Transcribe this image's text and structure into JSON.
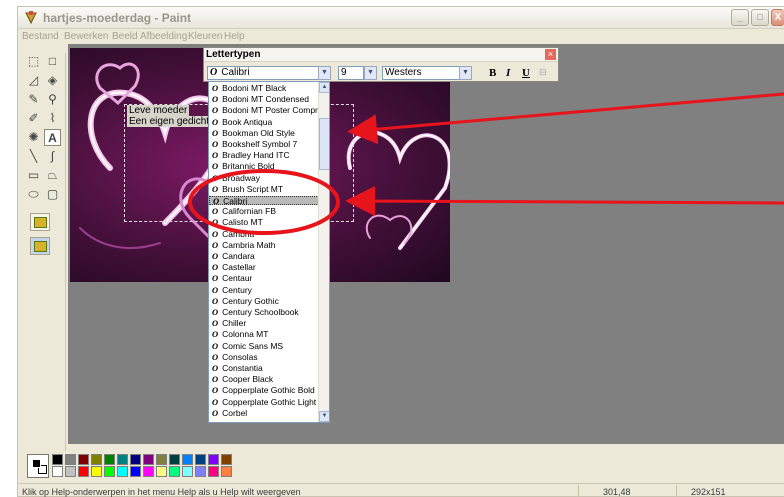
{
  "window": {
    "title": "hartjes-moederdag - Paint",
    "buttons": [
      "_",
      "□",
      "X"
    ]
  },
  "menu": [
    "Bestand",
    "Bewerken",
    "Beeld",
    "Afbeelding",
    "Kleuren",
    "Help"
  ],
  "toolbox": {
    "tools": [
      {
        "icon": "free-select-icon",
        "glyph": "⬚"
      },
      {
        "icon": "rect-select-icon",
        "glyph": "□"
      },
      {
        "icon": "eraser-icon",
        "glyph": "◿"
      },
      {
        "icon": "fill-icon",
        "glyph": "◈"
      },
      {
        "icon": "color-picker-icon",
        "glyph": "✎"
      },
      {
        "icon": "magnifier-icon",
        "glyph": "⚲"
      },
      {
        "icon": "pencil-icon",
        "glyph": "✐"
      },
      {
        "icon": "brush-icon",
        "glyph": "⌇"
      },
      {
        "icon": "airbrush-icon",
        "glyph": "✺"
      },
      {
        "icon": "text-icon",
        "glyph": "A"
      },
      {
        "icon": "line-icon",
        "glyph": "╲"
      },
      {
        "icon": "curve-icon",
        "glyph": "∫"
      },
      {
        "icon": "rectangle-icon",
        "glyph": "▭"
      },
      {
        "icon": "polygon-icon",
        "glyph": "⏢"
      },
      {
        "icon": "ellipse-icon",
        "glyph": "⬭"
      },
      {
        "icon": "rounded-rect-icon",
        "glyph": "▢"
      }
    ]
  },
  "canvas": {
    "text_lines": [
      "Leve moeder",
      "Een eigen gedicht is"
    ]
  },
  "font_toolbar": {
    "title": "Lettertypen",
    "font": "Calibri",
    "size": "9",
    "script": "Westers",
    "bold": "B",
    "italic": "I",
    "underline": "U",
    "close": "×"
  },
  "font_list": {
    "items": [
      "Bodoni MT Black",
      "Bodoni MT Condensed",
      "Bodoni MT Poster Compre",
      "Book Antiqua",
      "Bookman Old Style",
      "Bookshelf Symbol 7",
      "Bradley Hand ITC",
      "Britannic Bold",
      "Broadway",
      "Brush Script MT",
      "Calibri",
      "Californian FB",
      "Calisto MT",
      "Cambria",
      "Cambria Math",
      "Candara",
      "Castellar",
      "Centaur",
      "Century",
      "Century Gothic",
      "Century Schoolbook",
      "Chiller",
      "Colonna MT",
      "Comic Sans MS",
      "Consolas",
      "Constantia",
      "Cooper Black",
      "Copperplate Gothic Bold",
      "Copperplate Gothic Light",
      "Corbel"
    ],
    "selected": "Calibri"
  },
  "palette": {
    "row1": [
      "#000000",
      "#808080",
      "#800000",
      "#808000",
      "#008000",
      "#008080",
      "#000080",
      "#800080",
      "#808040",
      "#004040",
      "#0080ff",
      "#004080",
      "#8000ff",
      "#804000"
    ],
    "row2": [
      "#ffffff",
      "#c0c0c0",
      "#ff0000",
      "#ffff00",
      "#00ff00",
      "#00ffff",
      "#0000ff",
      "#ff00ff",
      "#ffff80",
      "#00ff80",
      "#80ffff",
      "#8080ff",
      "#ff0080",
      "#ff8040"
    ]
  },
  "status": {
    "help": "Klik op Help-onderwerpen in het menu Help als u Help wilt weergeven",
    "coords": "301,48",
    "size": "292x151"
  },
  "colors": {
    "annotation_red": "#e8141c"
  }
}
